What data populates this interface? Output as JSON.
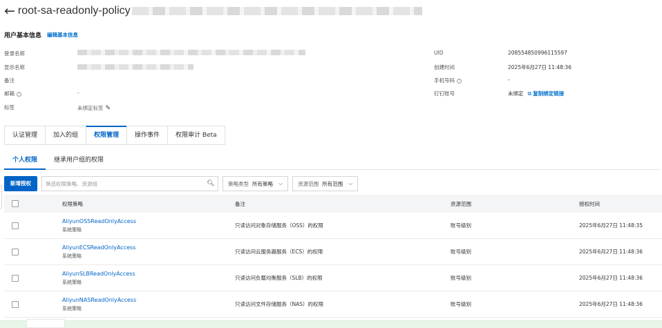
{
  "header": {
    "back_icon": "arrow-left-icon",
    "title": "root-sa-readonly-policy"
  },
  "basic_info": {
    "section_title": "用户基本信息",
    "edit_link": "编辑基本信息"
  },
  "left_fields": [
    {
      "label": "登录名称",
      "value": ""
    },
    {
      "label": "显示名称",
      "value": ""
    },
    {
      "label": "备注",
      "value": ""
    },
    {
      "label": "邮箱",
      "value": "-"
    },
    {
      "label": "标签",
      "value": "未绑定标签"
    }
  ],
  "right_fields": {
    "uid_label": "UID",
    "uid_value": "208554850996115597",
    "created_label": "创建时间",
    "created_value": "2025年6月27日 11:48:36",
    "phone_label": "手机号码",
    "phone_value": "-",
    "dingtalk_label": "钉钉账号",
    "dingtalk_value": "未绑定",
    "dingtalk_copy": "复制绑定链接"
  },
  "tabs": [
    "认证管理",
    "加入的组",
    "权限管理",
    "操作事件",
    "权限审计 Beta"
  ],
  "active_tab": "权限管理",
  "subtabs": [
    "个人权限",
    "继承用户组的权限"
  ],
  "toolbar": {
    "new_button": "新增授权",
    "search_placeholder": "筛选权限策略、资源组",
    "filter1_label": "策略类型",
    "filter1_value": "所有策略",
    "filter2_label": "资源范围",
    "filter2_value": "所有范围"
  },
  "table": {
    "headers": {
      "policy": "权限策略",
      "note": "备注",
      "scope": "资源范围",
      "time": "授权时间"
    },
    "rows": [
      {
        "name": "AliyunOSSReadOnlyAccess",
        "type": "系统策略",
        "note": "只读访问对象存储服务（OSS）的权限",
        "scope": "账号级别",
        "time": "2025年6月27日 11:48:35"
      },
      {
        "name": "AliyunECSReadOnlyAccess",
        "type": "系统策略",
        "note": "只读访问云服务器服务（ECS）的权限",
        "scope": "账号级别",
        "time": "2025年6月27日 11:48:36"
      },
      {
        "name": "AliyunSLBReadOnlyAccess",
        "type": "系统策略",
        "note": "只读访问负载均衡服务（SLB）的权限",
        "scope": "账号级别",
        "time": "2025年6月27日 11:48:36"
      },
      {
        "name": "AliyunNASReadOnlyAccess",
        "type": "系统策略",
        "note": "只读访问文件存储服务（NAS）的权限",
        "scope": "账号级别",
        "time": "2025年6月27日 11:48:36"
      }
    ]
  },
  "colors": {
    "accent": "#0064c8",
    "link": "#0070cc",
    "header_bg": "#f4f5f7",
    "bottom_bar": "#e8f5e9"
  }
}
